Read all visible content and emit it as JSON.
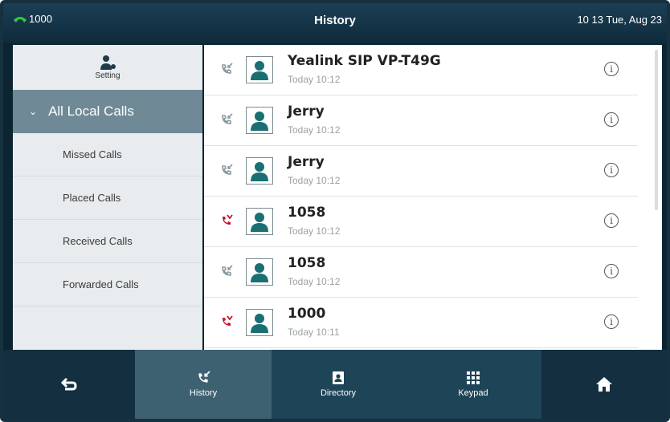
{
  "status": {
    "line": "1000",
    "title": "History",
    "datetime": "10 13 Tue, Aug 23",
    "line_icon": "phone-handset-icon"
  },
  "sidebar": {
    "setting_label": "Setting",
    "active_item": "All Local Calls",
    "items": [
      {
        "label": "Missed Calls"
      },
      {
        "label": "Placed Calls"
      },
      {
        "label": "Received Calls"
      },
      {
        "label": "Forwarded Calls"
      }
    ]
  },
  "calls": [
    {
      "name": "Yealink SIP VP-T49G",
      "time": "Today 10:12",
      "type": "received",
      "icon": "incoming-call-icon"
    },
    {
      "name": "Jerry",
      "time": "Today 10:12",
      "type": "received",
      "icon": "incoming-call-icon"
    },
    {
      "name": "Jerry",
      "time": "Today 10:12",
      "type": "received",
      "icon": "incoming-call-icon"
    },
    {
      "name": "1058",
      "time": "Today 10:12",
      "type": "missed",
      "icon": "missed-call-icon"
    },
    {
      "name": "1058",
      "time": "Today 10:12",
      "type": "received",
      "icon": "incoming-call-icon"
    },
    {
      "name": "1000",
      "time": "Today 10:11",
      "type": "missed",
      "icon": "missed-call-icon"
    }
  ],
  "bottom": {
    "history_label": "History",
    "directory_label": "Directory",
    "keypad_label": "Keypad"
  },
  "colors": {
    "missed": "#c8102e",
    "received": "#8a9aa0",
    "accent": "#6f8a96",
    "avatar": "#1a6f73"
  }
}
